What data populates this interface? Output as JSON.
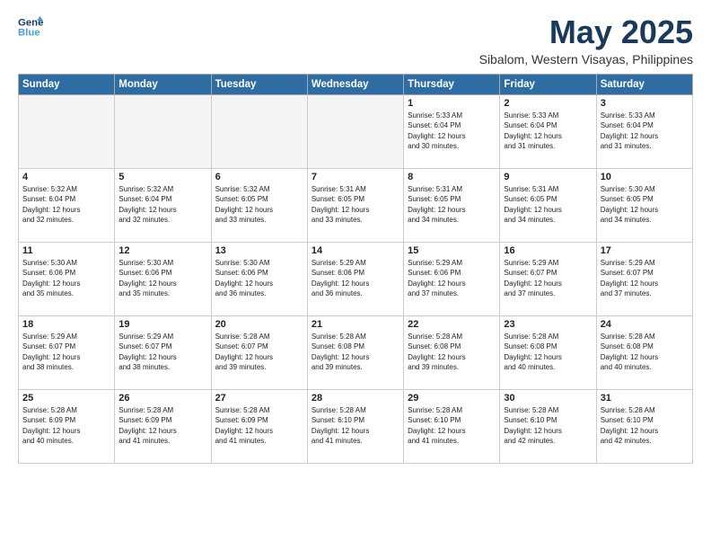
{
  "header": {
    "logo_line1": "General",
    "logo_line2": "Blue",
    "month_title": "May 2025",
    "location": "Sibalom, Western Visayas, Philippines"
  },
  "weekdays": [
    "Sunday",
    "Monday",
    "Tuesday",
    "Wednesday",
    "Thursday",
    "Friday",
    "Saturday"
  ],
  "rows": [
    [
      {
        "day": "",
        "text": ""
      },
      {
        "day": "",
        "text": ""
      },
      {
        "day": "",
        "text": ""
      },
      {
        "day": "",
        "text": ""
      },
      {
        "day": "1",
        "text": "Sunrise: 5:33 AM\nSunset: 6:04 PM\nDaylight: 12 hours\nand 30 minutes."
      },
      {
        "day": "2",
        "text": "Sunrise: 5:33 AM\nSunset: 6:04 PM\nDaylight: 12 hours\nand 31 minutes."
      },
      {
        "day": "3",
        "text": "Sunrise: 5:33 AM\nSunset: 6:04 PM\nDaylight: 12 hours\nand 31 minutes."
      }
    ],
    [
      {
        "day": "4",
        "text": "Sunrise: 5:32 AM\nSunset: 6:04 PM\nDaylight: 12 hours\nand 32 minutes."
      },
      {
        "day": "5",
        "text": "Sunrise: 5:32 AM\nSunset: 6:04 PM\nDaylight: 12 hours\nand 32 minutes."
      },
      {
        "day": "6",
        "text": "Sunrise: 5:32 AM\nSunset: 6:05 PM\nDaylight: 12 hours\nand 33 minutes."
      },
      {
        "day": "7",
        "text": "Sunrise: 5:31 AM\nSunset: 6:05 PM\nDaylight: 12 hours\nand 33 minutes."
      },
      {
        "day": "8",
        "text": "Sunrise: 5:31 AM\nSunset: 6:05 PM\nDaylight: 12 hours\nand 34 minutes."
      },
      {
        "day": "9",
        "text": "Sunrise: 5:31 AM\nSunset: 6:05 PM\nDaylight: 12 hours\nand 34 minutes."
      },
      {
        "day": "10",
        "text": "Sunrise: 5:30 AM\nSunset: 6:05 PM\nDaylight: 12 hours\nand 34 minutes."
      }
    ],
    [
      {
        "day": "11",
        "text": "Sunrise: 5:30 AM\nSunset: 6:06 PM\nDaylight: 12 hours\nand 35 minutes."
      },
      {
        "day": "12",
        "text": "Sunrise: 5:30 AM\nSunset: 6:06 PM\nDaylight: 12 hours\nand 35 minutes."
      },
      {
        "day": "13",
        "text": "Sunrise: 5:30 AM\nSunset: 6:06 PM\nDaylight: 12 hours\nand 36 minutes."
      },
      {
        "day": "14",
        "text": "Sunrise: 5:29 AM\nSunset: 6:06 PM\nDaylight: 12 hours\nand 36 minutes."
      },
      {
        "day": "15",
        "text": "Sunrise: 5:29 AM\nSunset: 6:06 PM\nDaylight: 12 hours\nand 37 minutes."
      },
      {
        "day": "16",
        "text": "Sunrise: 5:29 AM\nSunset: 6:07 PM\nDaylight: 12 hours\nand 37 minutes."
      },
      {
        "day": "17",
        "text": "Sunrise: 5:29 AM\nSunset: 6:07 PM\nDaylight: 12 hours\nand 37 minutes."
      }
    ],
    [
      {
        "day": "18",
        "text": "Sunrise: 5:29 AM\nSunset: 6:07 PM\nDaylight: 12 hours\nand 38 minutes."
      },
      {
        "day": "19",
        "text": "Sunrise: 5:29 AM\nSunset: 6:07 PM\nDaylight: 12 hours\nand 38 minutes."
      },
      {
        "day": "20",
        "text": "Sunrise: 5:28 AM\nSunset: 6:07 PM\nDaylight: 12 hours\nand 39 minutes."
      },
      {
        "day": "21",
        "text": "Sunrise: 5:28 AM\nSunset: 6:08 PM\nDaylight: 12 hours\nand 39 minutes."
      },
      {
        "day": "22",
        "text": "Sunrise: 5:28 AM\nSunset: 6:08 PM\nDaylight: 12 hours\nand 39 minutes."
      },
      {
        "day": "23",
        "text": "Sunrise: 5:28 AM\nSunset: 6:08 PM\nDaylight: 12 hours\nand 40 minutes."
      },
      {
        "day": "24",
        "text": "Sunrise: 5:28 AM\nSunset: 6:08 PM\nDaylight: 12 hours\nand 40 minutes."
      }
    ],
    [
      {
        "day": "25",
        "text": "Sunrise: 5:28 AM\nSunset: 6:09 PM\nDaylight: 12 hours\nand 40 minutes."
      },
      {
        "day": "26",
        "text": "Sunrise: 5:28 AM\nSunset: 6:09 PM\nDaylight: 12 hours\nand 41 minutes."
      },
      {
        "day": "27",
        "text": "Sunrise: 5:28 AM\nSunset: 6:09 PM\nDaylight: 12 hours\nand 41 minutes."
      },
      {
        "day": "28",
        "text": "Sunrise: 5:28 AM\nSunset: 6:10 PM\nDaylight: 12 hours\nand 41 minutes."
      },
      {
        "day": "29",
        "text": "Sunrise: 5:28 AM\nSunset: 6:10 PM\nDaylight: 12 hours\nand 41 minutes."
      },
      {
        "day": "30",
        "text": "Sunrise: 5:28 AM\nSunset: 6:10 PM\nDaylight: 12 hours\nand 42 minutes."
      },
      {
        "day": "31",
        "text": "Sunrise: 5:28 AM\nSunset: 6:10 PM\nDaylight: 12 hours\nand 42 minutes."
      }
    ]
  ]
}
